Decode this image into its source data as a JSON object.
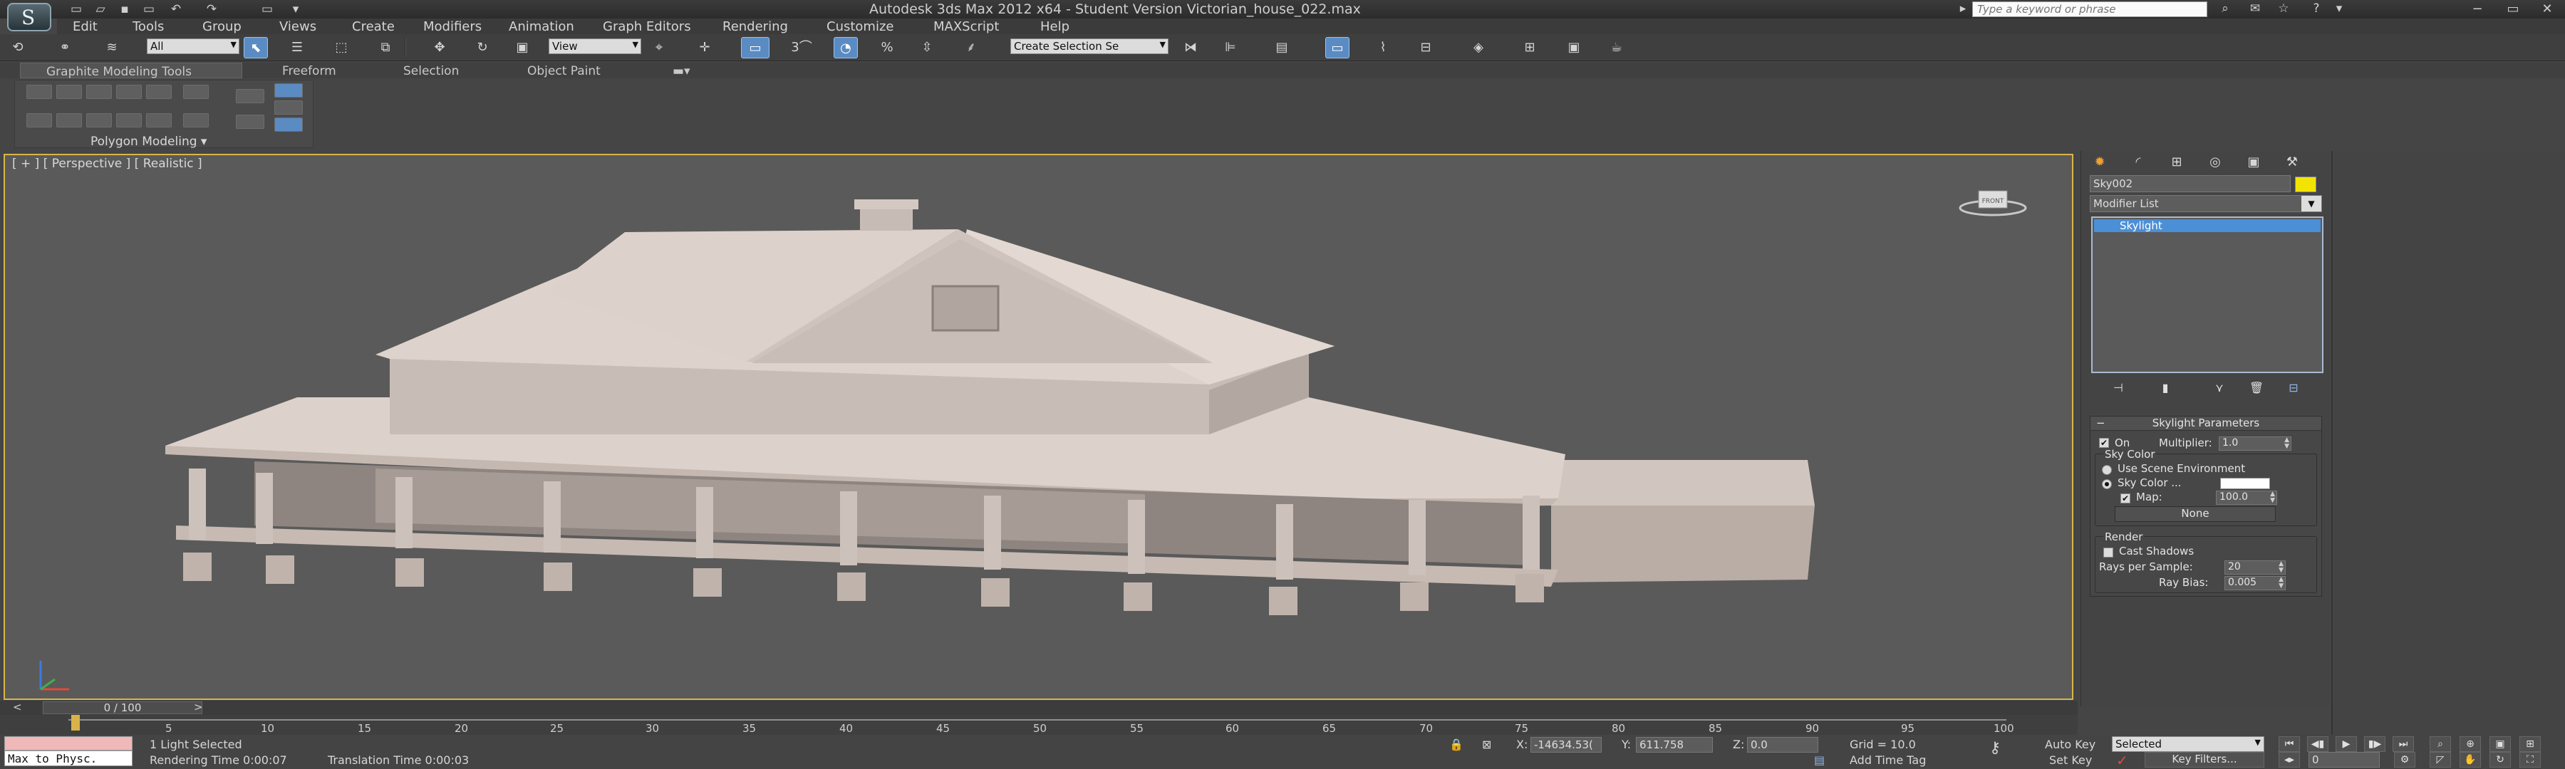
{
  "title": "Autodesk 3ds Max  2012 x64  - Student Version   Victorian_house_022.max",
  "search": {
    "placeholder": "Type a keyword or phrase"
  },
  "menu": [
    "Edit",
    "Tools",
    "Group",
    "Views",
    "Create",
    "Modifiers",
    "Animation",
    "Graph Editors",
    "Rendering",
    "Customize",
    "MAXScript",
    "Help"
  ],
  "toolbar": {
    "selection_filter": "All",
    "reference_coord": "View",
    "named_selection": "Create Selection Se",
    "snap_label": "3",
    "angle_snap_label": "%"
  },
  "ribbon": {
    "tabs": [
      "Graphite Modeling Tools",
      "Freeform",
      "Selection",
      "Object Paint"
    ],
    "panel_label": "Polygon Modeling"
  },
  "viewport": {
    "label": "[ + ] [ Perspective ] [ Realistic ]",
    "viewcube_label": "FRONT"
  },
  "timeline": {
    "frame_display": "0 / 100",
    "ticks": [
      "5",
      "10",
      "15",
      "20",
      "25",
      "30",
      "35",
      "40",
      "45",
      "50",
      "55",
      "60",
      "65",
      "70",
      "75",
      "80",
      "85",
      "90",
      "95",
      "100"
    ]
  },
  "status": {
    "maxscript_text": "Max to Physc.",
    "selected": "1 Light Selected",
    "render_time": "Rendering Time  0:00:07",
    "translation_time": "Translation Time  0:00:03",
    "x_label": "X:",
    "x_value": "-14634.53(",
    "y_label": "Y:",
    "y_value": "611.758",
    "z_label": "Z:",
    "z_value": "0.0",
    "grid": "Grid = 10.0",
    "add_time_tag": "Add Time Tag",
    "auto_key": "Auto Key",
    "set_key": "Set Key",
    "selected_drop": "Selected",
    "key_filters": "Key Filters...",
    "frame_field": "0"
  },
  "command_panel": {
    "object_name": "Sky002",
    "modifier_list": "Modifier List",
    "stack_item": "Skylight",
    "rollout": {
      "title": "Skylight Parameters",
      "on_label": "On",
      "multiplier_label": "Multiplier:",
      "multiplier_value": "1.0",
      "sky_color_group": "Sky Color",
      "use_scene_env": "Use Scene Environment",
      "sky_color_label": "Sky Color ...",
      "map_label": "Map:",
      "map_value": "100.0",
      "none_button": "None",
      "render_group": "Render",
      "cast_shadows": "Cast Shadows",
      "rays_label": "Rays per Sample:",
      "rays_value": "20",
      "ray_bias_label": "Ray Bias:",
      "ray_bias_value": "0.005"
    }
  },
  "colors": {
    "accent": "#5a8bc3",
    "viewport_border": "#d9b54b",
    "object_color": "#f2e400",
    "stack_selected": "#4b8fd6"
  }
}
